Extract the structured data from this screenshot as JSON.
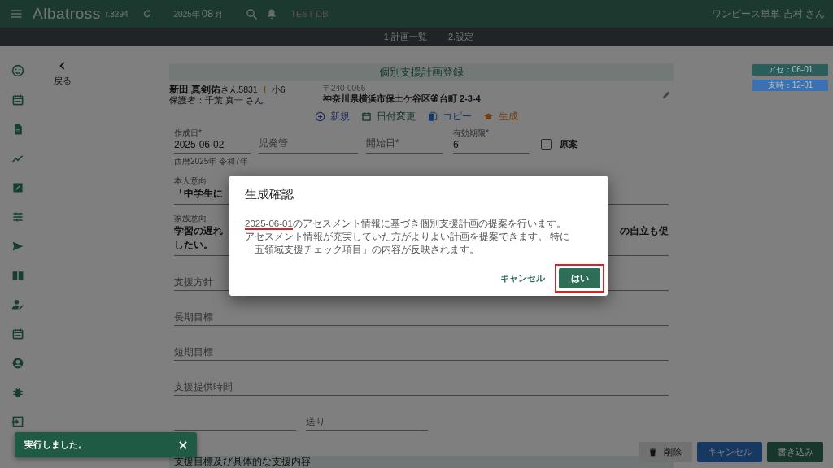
{
  "header": {
    "app_name": "Albatross",
    "revision": "r.3294",
    "year": "2025年",
    "month": "08",
    "month_unit": "月",
    "db_label": "TEST DB",
    "user": "ワンピース単単 吉村 さん"
  },
  "nav_tabs": [
    {
      "label": "1.計画一覧"
    },
    {
      "label": "2.設定"
    }
  ],
  "back": {
    "label": "戻る"
  },
  "page_title": "個別支援計画登録",
  "badges": [
    {
      "label": "アセ：06-01",
      "color": "#2a5e5b"
    },
    {
      "label": "支時：12-01",
      "color": "#3b70b3"
    }
  ],
  "student": {
    "name": "新田 真剣佑",
    "honorific": "さん",
    "number": "5831",
    "alert": "！",
    "grade": "小6",
    "guardian": "保護者：千葉 真一 さん",
    "postal": "〒240-0066",
    "address": "神奈川県横浜市保土ケ谷区釜台町 2-3-4"
  },
  "actions": [
    {
      "label": "新規",
      "kind": "new"
    },
    {
      "label": "日付変更",
      "kind": "date"
    },
    {
      "label": "コピー",
      "kind": "copy"
    },
    {
      "label": "生成",
      "kind": "generate"
    }
  ],
  "fields_row": [
    {
      "label": "作成日*",
      "value": "2025-06-02"
    },
    {
      "placeholder": "児発管"
    },
    {
      "placeholder": "開始日*"
    },
    {
      "label": "有効期限*",
      "value": "6"
    }
  ],
  "draft": {
    "label": "原案",
    "checked": false
  },
  "era_note": "西暦2025年 令和7年",
  "intention": {
    "label": "本人意向",
    "value": "「中学生に"
  },
  "family": {
    "label": "家族意向",
    "value_left": "学習の遅れ",
    "value_right": "の自立も促",
    "value_line2": "したい。"
  },
  "text_fields": [
    {
      "placeholder": "支援方針"
    },
    {
      "placeholder": "長期目標"
    },
    {
      "placeholder": "短期目標"
    },
    {
      "placeholder": "支援提供時間"
    }
  ],
  "transfer_field": {
    "placeholder": "送り"
  },
  "section_header": "支援目標及び具体的な支援内容",
  "footer_buttons": [
    {
      "label": "削除",
      "kind": "delete"
    },
    {
      "label": "キャンセル",
      "kind": "cancel"
    },
    {
      "label": "書き込み",
      "kind": "save"
    }
  ],
  "snackbar": {
    "message": "実行しました。"
  },
  "dialog": {
    "title": "生成確認",
    "date": "2025-06-01",
    "date_underlined": true,
    "lines": [
      "のアセスメント情報に基づき個別支援計画の提案を行います。",
      "アセスメント情報が充実していた方がよりよい計画を提案できます。 特に",
      "「五領域支援チェック項目」の内容が反映されます。"
    ],
    "cancel": "キャンセル",
    "confirm": {
      "label": "はい",
      "highlighted": true
    }
  }
}
